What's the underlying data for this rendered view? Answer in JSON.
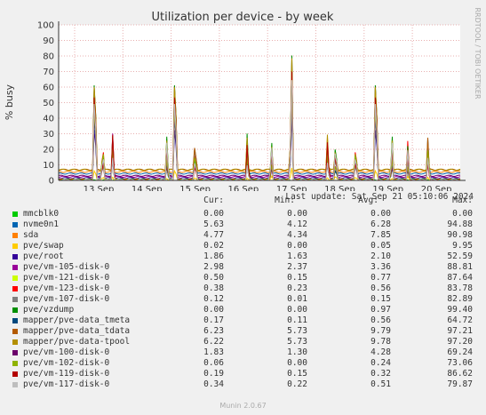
{
  "chart_data": {
    "type": "line",
    "title": "Utilization per device - by week",
    "ylabel": "% busy",
    "ylim": [
      0,
      100
    ],
    "y_ticks": [
      0,
      10,
      20,
      30,
      40,
      50,
      60,
      70,
      80,
      90,
      100
    ],
    "x_ticks": [
      "13 Sep",
      "14 Sep",
      "15 Sep",
      "16 Sep",
      "17 Sep",
      "18 Sep",
      "19 Sep",
      "20 Sep"
    ],
    "grid": true,
    "columns": [
      "Cur:",
      "Min:",
      "Avg:",
      "Max:"
    ],
    "series": [
      {
        "name": "mmcblk0",
        "color": "#00cc00",
        "cur": "0.00",
        "min": "0.00",
        "avg": "0.00",
        "max": "0.00"
      },
      {
        "name": "nvme0n1",
        "color": "#0066b3",
        "cur": "5.63",
        "min": "4.12",
        "avg": "6.28",
        "max": "94.88"
      },
      {
        "name": "sda",
        "color": "#ff8000",
        "cur": "4.77",
        "min": "4.34",
        "avg": "7.85",
        "max": "90.98"
      },
      {
        "name": "pve/swap",
        "color": "#ffcc00",
        "cur": "0.02",
        "min": "0.00",
        "avg": "0.05",
        "max": "9.95"
      },
      {
        "name": "pve/root",
        "color": "#330099",
        "cur": "1.86",
        "min": "1.63",
        "avg": "2.10",
        "max": "52.59"
      },
      {
        "name": "pve/vm-105-disk-0",
        "color": "#990099",
        "cur": "2.98",
        "min": "2.37",
        "avg": "3.36",
        "max": "88.81"
      },
      {
        "name": "pve/vm-121-disk-0",
        "color": "#ccff00",
        "cur": "0.50",
        "min": "0.15",
        "avg": "0.77",
        "max": "87.64"
      },
      {
        "name": "pve/vm-123-disk-0",
        "color": "#ff0000",
        "cur": "0.38",
        "min": "0.23",
        "avg": "0.56",
        "max": "83.78"
      },
      {
        "name": "pve/vm-107-disk-0",
        "color": "#808080",
        "cur": "0.12",
        "min": "0.01",
        "avg": "0.15",
        "max": "82.89"
      },
      {
        "name": "pve/vzdump",
        "color": "#008f00",
        "cur": "0.00",
        "min": "0.00",
        "avg": "0.97",
        "max": "99.40"
      },
      {
        "name": "mapper/pve-data_tmeta",
        "color": "#00487d",
        "cur": "0.17",
        "min": "0.11",
        "avg": "0.56",
        "max": "64.72"
      },
      {
        "name": "mapper/pve-data_tdata",
        "color": "#b35a00",
        "cur": "6.23",
        "min": "5.73",
        "avg": "9.79",
        "max": "97.21"
      },
      {
        "name": "mapper/pve-data-tpool",
        "color": "#b38f00",
        "cur": "6.22",
        "min": "5.73",
        "avg": "9.78",
        "max": "97.20"
      },
      {
        "name": "pve/vm-100-disk-0",
        "color": "#6b006b",
        "cur": "1.83",
        "min": "1.30",
        "avg": "4.28",
        "max": "69.24"
      },
      {
        "name": "pve/vm-102-disk-0",
        "color": "#8fb300",
        "cur": "0.06",
        "min": "0.00",
        "avg": "0.24",
        "max": "73.06"
      },
      {
        "name": "pve/vm-119-disk-0",
        "color": "#b30000",
        "cur": "0.19",
        "min": "0.15",
        "avg": "0.32",
        "max": "86.62"
      },
      {
        "name": "pve/vm-117-disk-0",
        "color": "#bebebe",
        "cur": "0.34",
        "min": "0.22",
        "avg": "0.51",
        "max": "79.87"
      }
    ]
  },
  "last_update": "Last update: Sat Sep 21 05:10:06 2024",
  "side_label": "RRDTOOL / TOBI OETIKER",
  "footer": "Munin 2.0.67"
}
